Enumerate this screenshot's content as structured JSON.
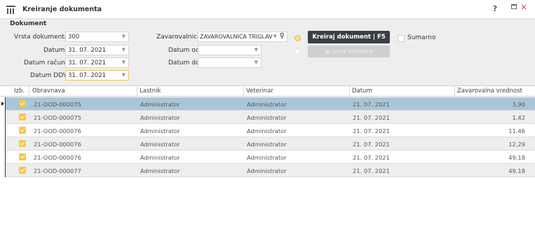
{
  "window": {
    "title": "Kreiranje dokumenta",
    "help_label": "?",
    "close_label": "×"
  },
  "form": {
    "section_title": "Dokument",
    "vrsta_label": "Vrsta dokumenta",
    "vrsta_value": "300",
    "datum_label": "Datum",
    "datum_value": "31. 07. 2021",
    "datum_racuna_label": "Datum računa",
    "datum_racuna_value": "31. 07. 2021",
    "datum_ddv_label": "Datum DDV",
    "datum_ddv_value": "31. 07. 2021",
    "zavarovalnica_label": "Zavarovalnica",
    "zavarovalnica_value": "ZAVAROVALNICA TRIGLAV",
    "datum_od_label": "Datum od",
    "datum_od_value": "",
    "datum_do_label": "Datum do",
    "datum_do_value": "",
    "create_button_label": "Kreiraj dokument | F5",
    "export_button_label": "Izvoz datoteke",
    "sumarno_label": "Sumarno"
  },
  "table": {
    "columns": [
      "Izb.",
      "Obravnava",
      "Lastnik",
      "Veterinar",
      "Datum",
      "Zavarovalna vrednost"
    ],
    "rows": [
      {
        "obravnava": "21-OOD-000075",
        "lastnik": "Administrator",
        "veterinar": "Administrator",
        "datum": "21. 07. 2021",
        "vrednost": "3,90"
      },
      {
        "obravnava": "21-OOD-000075",
        "lastnik": "Administrator",
        "veterinar": "Administrator",
        "datum": "21. 07. 2021",
        "vrednost": "1,42"
      },
      {
        "obravnava": "21-OOD-000076",
        "lastnik": "Administrator",
        "veterinar": "Administrator",
        "datum": "21. 07. 2021",
        "vrednost": "11,46"
      },
      {
        "obravnava": "21-OOD-000076",
        "lastnik": "Administrator",
        "veterinar": "Administrator",
        "datum": "21. 07. 2021",
        "vrednost": "12,29"
      },
      {
        "obravnava": "21-OOD-000076",
        "lastnik": "Administrator",
        "veterinar": "Administrator",
        "datum": "21. 07. 2021",
        "vrednost": "49,18"
      },
      {
        "obravnava": "21-OOD-000077",
        "lastnik": "Administrator",
        "veterinar": "Administrator",
        "datum": "21. 07. 2021",
        "vrednost": "49,18"
      }
    ]
  },
  "colors": {
    "accent": "#f7c64a",
    "selected_row": "#a9c6d9",
    "primary_button": "#3a3f47"
  }
}
